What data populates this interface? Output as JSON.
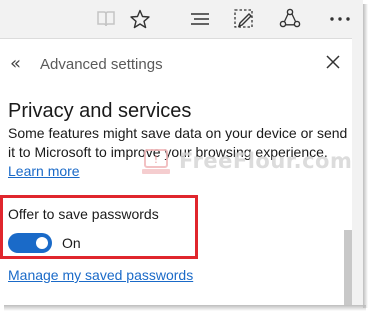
{
  "panel": {
    "header_title": "Advanced settings",
    "back_glyph": "«"
  },
  "privacy": {
    "title": "Privacy and services",
    "description": "Some features might save data on your device or send it to Microsoft to improve your browsing experience.",
    "learn_more": "Learn more"
  },
  "passwords": {
    "offer_label": "Offer to save passwords",
    "toggle_state": "On",
    "toggle_on": true,
    "manage_link": "Manage my saved passwords"
  },
  "watermark": {
    "text": "FreeFlour.com"
  },
  "toolbar": {
    "icons": [
      "reading-view-icon",
      "favorite-star-icon",
      "hub-icon",
      "web-note-icon",
      "share-icon",
      "more-icon"
    ]
  },
  "colors": {
    "accent": "#1a6ac8",
    "highlight": "#e0262d"
  }
}
